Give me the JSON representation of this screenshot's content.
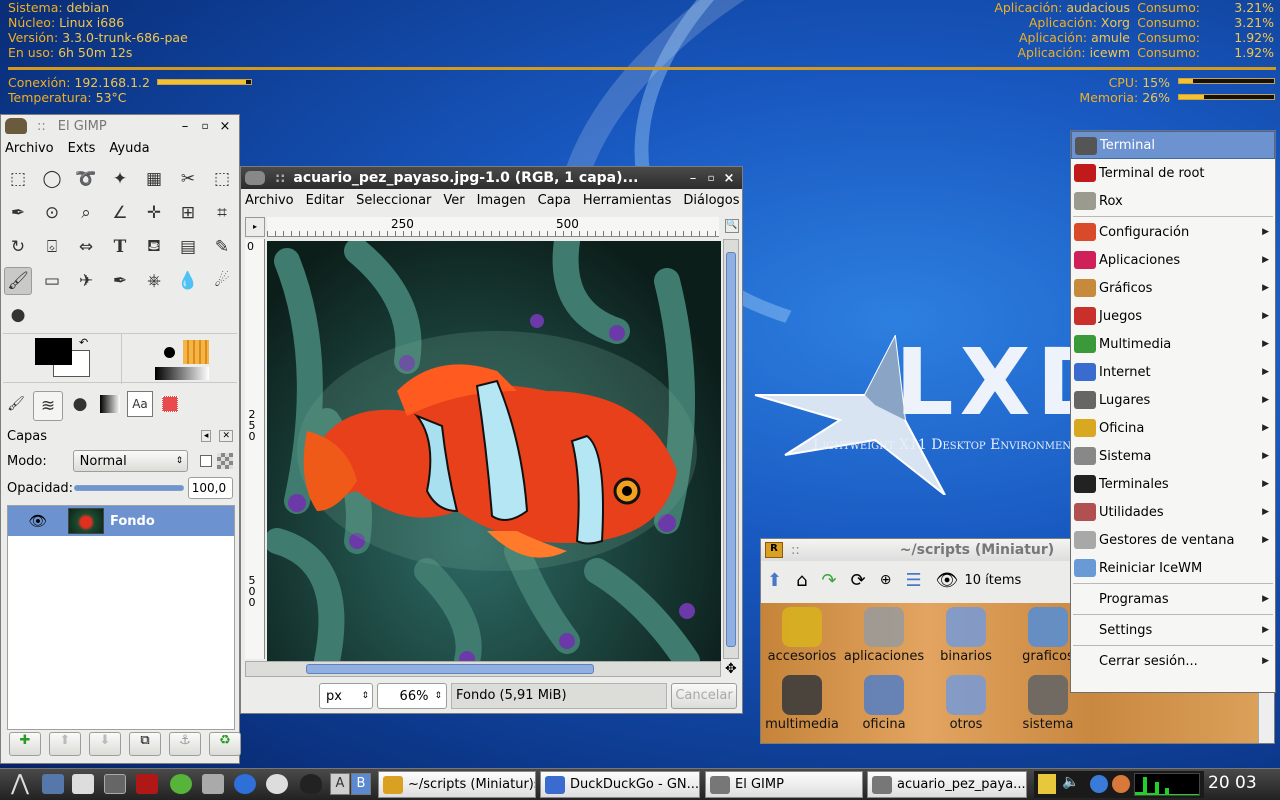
{
  "conky": {
    "left": [
      {
        "label": "Sistema:",
        "value": "debian"
      },
      {
        "label": "Núcleo:",
        "value": "Linux i686"
      },
      {
        "label": "Versión:",
        "value": "3.3.0-trunk-686-pae"
      },
      {
        "label": "En uso:",
        "value": "6h 50m 12s"
      }
    ],
    "conexion_label": "Conexión:",
    "conexion_value": "192.168.1.2",
    "conexion_level": 0.95,
    "temp_label": "Temperatura:",
    "temp_value": "53°C",
    "apps": [
      {
        "app_label": "Aplicación:",
        "app": "audacious",
        "cons_label": "Consumo:",
        "cons": "3.21%"
      },
      {
        "app_label": "Aplicación:",
        "app": "Xorg",
        "cons_label": "Consumo:",
        "cons": "3.21%"
      },
      {
        "app_label": "Aplicación:",
        "app": "amule",
        "cons_label": "Consumo:",
        "cons": "1.92%"
      },
      {
        "app_label": "Aplicación:",
        "app": "icewm",
        "cons_label": "Consumo:",
        "cons": "1.92%"
      }
    ],
    "cpu_label": "CPU:",
    "cpu_value": "15%",
    "cpu_level": 0.15,
    "mem_label": "Memoria:",
    "mem_value": "26%",
    "mem_level": 0.26
  },
  "wallpaper": {
    "logo_text": "LXDE",
    "tagline": "Lightweight X11 Desktop Environment"
  },
  "toolbox": {
    "title": "El GIMP",
    "menu": [
      "Archivo",
      "Exts",
      "Ayuda"
    ],
    "layers_title": "Capas",
    "mode_label": "Modo:",
    "mode_value": "Normal",
    "opacity_label": "Opacidad:",
    "opacity_value": "100,0",
    "opacity_level": 1.0,
    "layer_name": "Fondo"
  },
  "image_window": {
    "title": "acuario_pez_payaso.jpg-1.0 (RGB, 1 capa)...",
    "menu": [
      "Archivo",
      "Editar",
      "Seleccionar",
      "Ver",
      "Imagen",
      "Capa",
      "Herramientas",
      "Diálogos"
    ],
    "ruler_top": [
      "250",
      "500"
    ],
    "ruler_left": [
      "0",
      "250",
      "500"
    ],
    "unit": "px",
    "zoom": "66%",
    "status": "Fondo (5,91 MiB)",
    "cancel": "Cancelar"
  },
  "filemanager": {
    "title": "~/scripts (Miniatur)",
    "items_count": "10 ítems",
    "icons": [
      "accesorios",
      "aplicaciones",
      "binarios",
      "graficos",
      "multimedia",
      "oficina",
      "otros",
      "sistema"
    ]
  },
  "menu": {
    "items": [
      {
        "label": "Terminal",
        "icon": "terminal-icon",
        "color": "#555",
        "sub": false,
        "hl": true
      },
      {
        "label": "Terminal de root",
        "icon": "root-terminal-icon",
        "color": "#c01a1a",
        "sub": false
      },
      {
        "label": "Rox",
        "icon": "folder-icon",
        "color": "#9a9a8e",
        "sub": false,
        "sep": true
      },
      {
        "label": "Configuración",
        "icon": "tools-icon",
        "color": "#d84a2a",
        "sub": true
      },
      {
        "label": "Aplicaciones",
        "icon": "debian-icon",
        "color": "#d0205a",
        "sub": true
      },
      {
        "label": "Gráficos",
        "icon": "palette-icon",
        "color": "#c78a3c",
        "sub": true
      },
      {
        "label": "Juegos",
        "icon": "cards-icon",
        "color": "#c9302c",
        "sub": true
      },
      {
        "label": "Multimedia",
        "icon": "music-icon",
        "color": "#3a9a3a",
        "sub": true
      },
      {
        "label": "Internet",
        "icon": "globe-icon",
        "color": "#3a6cd0",
        "sub": true
      },
      {
        "label": "Lugares",
        "icon": "places-icon",
        "color": "#666",
        "sub": true
      },
      {
        "label": "Oficina",
        "icon": "books-icon",
        "color": "#d9a821",
        "sub": true
      },
      {
        "label": "Sistema",
        "icon": "gear-icon",
        "color": "#888",
        "sub": true
      },
      {
        "label": "Terminales",
        "icon": "terminals-icon",
        "color": "#222",
        "sub": true
      },
      {
        "label": "Utilidades",
        "icon": "utilities-icon",
        "color": "#b05050",
        "sub": true
      },
      {
        "label": "Gestores de ventana",
        "icon": "windows-icon",
        "color": "#a8a8a8",
        "sub": true
      },
      {
        "label": "Reiniciar IceWM",
        "icon": "icewm-icon",
        "color": "#6a9ad6",
        "sub": false,
        "sep": true
      },
      {
        "label": "Programas",
        "icon": "",
        "color": "",
        "sub": true,
        "sep": true
      },
      {
        "label": "Settings",
        "icon": "",
        "color": "",
        "sub": true,
        "sep": true
      },
      {
        "label": "Cerrar sesión...",
        "icon": "",
        "color": "",
        "sub": true
      }
    ]
  },
  "taskbar": {
    "workspaces": [
      "A",
      "B"
    ],
    "tasks": [
      {
        "label": "~/scripts (Miniatur)s",
        "icon": "rox-icon"
      },
      {
        "label": "DuckDuckGo - GN...",
        "icon": "browser-icon"
      },
      {
        "label": "El GIMP",
        "icon": "gimp-icon"
      },
      {
        "label": "acuario_pez_paya...",
        "icon": "gimp-icon"
      }
    ],
    "clock": "20 03"
  }
}
